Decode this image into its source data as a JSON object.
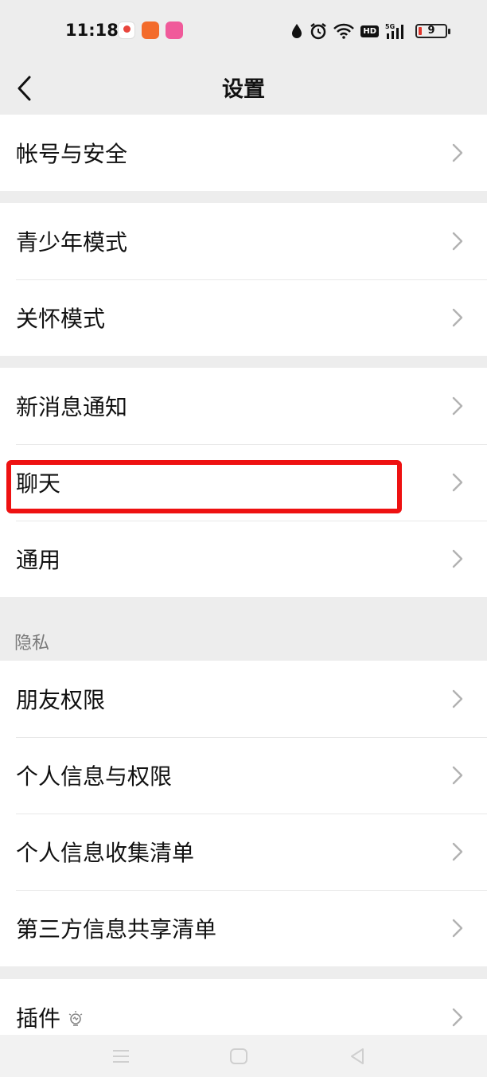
{
  "status_bar": {
    "time": "11:18",
    "battery_level": "9"
  },
  "header": {
    "title": "设置"
  },
  "groups": [
    {
      "items": [
        {
          "label": "帐号与安全"
        }
      ]
    },
    {
      "items": [
        {
          "label": "青少年模式"
        },
        {
          "label": "关怀模式"
        }
      ]
    },
    {
      "items": [
        {
          "label": "新消息通知"
        },
        {
          "label": "聊天"
        },
        {
          "label": "通用"
        }
      ]
    },
    {
      "title": "隐私",
      "items": [
        {
          "label": "朋友权限"
        },
        {
          "label": "个人信息与权限"
        },
        {
          "label": "个人信息收集清单"
        },
        {
          "label": "第三方信息共享清单"
        }
      ]
    },
    {
      "items": [
        {
          "label": "插件"
        }
      ]
    }
  ],
  "highlight": {
    "target": "聊天",
    "color": "#ee1111"
  },
  "colors": {
    "background": "#ededed",
    "card": "#ffffff",
    "chevron": "#b2b2b2"
  }
}
